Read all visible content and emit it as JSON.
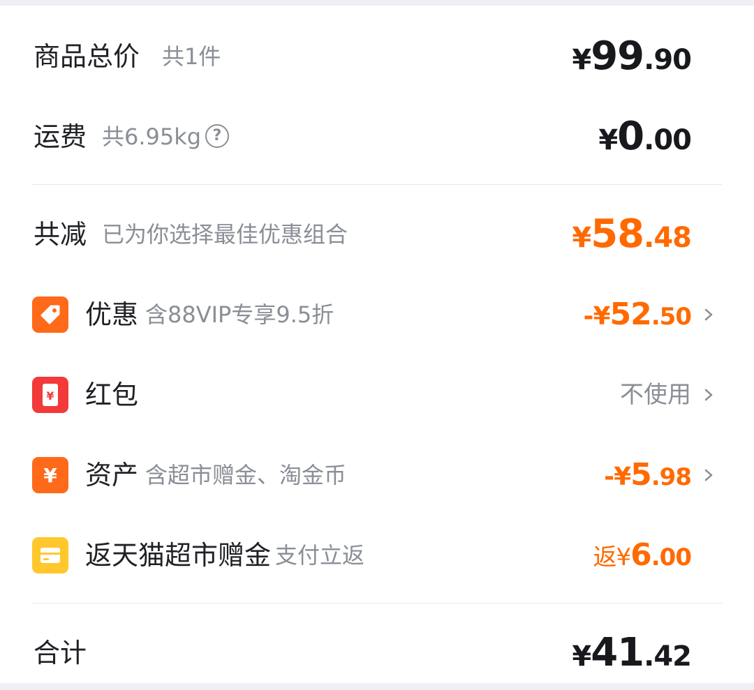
{
  "summary": {
    "goods_total": {
      "label": "商品总价",
      "sub": "共1件",
      "currency": "¥",
      "int": "99",
      "dec": ".90"
    },
    "shipping": {
      "label": "运费",
      "sub": "共6.95kg",
      "help_glyph": "?",
      "currency": "¥",
      "int": "0",
      "dec": ".00"
    },
    "reduction": {
      "label": "共减",
      "sub": "已为你选择最佳优惠组合",
      "currency": "¥",
      "int": "58",
      "dec": ".48"
    },
    "discount": {
      "label": "优惠",
      "sub": "含88VIP专享9.5折",
      "prefix": "-¥",
      "int": "52",
      "dec": ".50",
      "icon": "tag-icon"
    },
    "red_packet": {
      "label": "红包",
      "value": "不使用",
      "icon_glyph": "¥",
      "icon": "red-packet-icon"
    },
    "assets": {
      "label": "资产",
      "sub": "含超市赠金、淘金币",
      "prefix": "-¥",
      "int": "5",
      "dec": ".98",
      "icon_glyph": "¥",
      "icon": "yen-icon"
    },
    "cashback": {
      "label": "返天猫超市赠金",
      "sub": "支付立返",
      "prefix": "返¥",
      "int": "6",
      "dec": ".00",
      "icon": "card-icon"
    },
    "total": {
      "label": "合计",
      "currency": "¥",
      "int": "41",
      "dec": ".42"
    }
  },
  "colors": {
    "accent_orange": "#ff6a00",
    "red_packet": "#f23a3a",
    "gift_yellow": "#ffc72c",
    "text_dark": "#1f2126",
    "text_muted": "#8a8e96"
  }
}
